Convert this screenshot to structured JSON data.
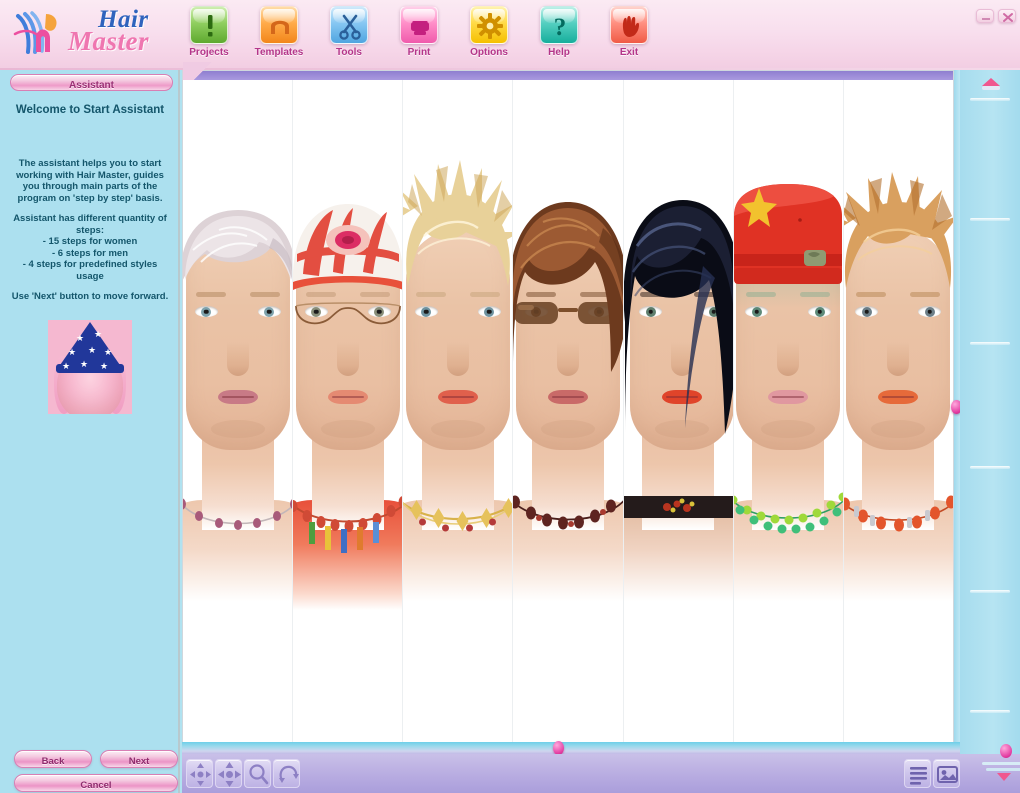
{
  "app": {
    "title_line1": "Hair",
    "title_line2": "Master",
    "logo_icon": "hm-monogram-icon"
  },
  "window_controls": [
    {
      "name": "minimize-button",
      "icon": "minimize-icon"
    },
    {
      "name": "close-button",
      "icon": "close-icon"
    }
  ],
  "toolbar": {
    "items": [
      {
        "label": "Projects",
        "icon": "exclamation-icon",
        "color": "#5ea92f"
      },
      {
        "label": "Templates",
        "icon": "hair-template-icon",
        "color": "#f2861a"
      },
      {
        "label": "Tools",
        "icon": "scissors-icon",
        "color": "#4fa5e0"
      },
      {
        "label": "Print",
        "icon": "printer-icon",
        "color": "#f05bac"
      },
      {
        "label": "Options",
        "icon": "gear-icon",
        "color": "#f5c000"
      },
      {
        "label": "Help",
        "icon": "question-mark-icon",
        "color": "#16ae9c"
      },
      {
        "label": "Exit",
        "icon": "hand-wave-icon",
        "color": "#f05b46"
      }
    ]
  },
  "sidebar": {
    "tab_label": "Assistant",
    "title": "Welcome to Start Assistant",
    "paragraph1": "The assistant helps you to start working with Hair Master, guides you through main parts of the program on 'step by step' basis.",
    "paragraph2_intro": "Assistant has different quantity of steps:",
    "steps": [
      "- 15 steps for women",
      "- 6 steps for men",
      "- 4 steps for predefined styles usage"
    ],
    "paragraph3": "Use 'Next' button to move forward.",
    "wizard_image_name": "assistant-wizard-portrait",
    "buttons": {
      "back": "Back",
      "next": "Next",
      "cancel": "Cancel"
    }
  },
  "canvas": {
    "name": "hairstyle-preview-canvas",
    "strips": [
      {
        "name": "portrait-strip-1",
        "hair_style": "short-platinum-pixie",
        "hair_color": "#e8dfe2",
        "hair_color_dark": "#c9bcc3",
        "skin": "#eac3a6",
        "eye_color": "#7fa3ad",
        "lip_color": "#c87a86",
        "accessory": "beaded-choker",
        "accessory_color": "#a85a7a"
      },
      {
        "name": "portrait-strip-2",
        "hair_style": "red-floral-headscarf",
        "hair_color": "#f2f0ee",
        "hair_color_dark": "#e03224",
        "skin": "#e9c0a2",
        "eye_color": "#8a8f7a",
        "lip_color": "#e58a72",
        "accessory": "coral-bead-necklace",
        "accessory_color": "#d04a36",
        "glasses": "rimless-oval-glasses"
      },
      {
        "name": "portrait-strip-3",
        "hair_style": "spiky-blonde",
        "hair_color": "#f0dda8",
        "hair_color_dark": "#cfa95e",
        "skin": "#ecc6a8",
        "eye_color": "#6f93a0",
        "lip_color": "#e0604c",
        "accessory": "gold-statement-necklace",
        "accessory_color": "#d8b24a"
      },
      {
        "name": "portrait-strip-4",
        "hair_style": "auburn-layered-bob",
        "hair_color": "#9c5a33",
        "hair_color_dark": "#6d3a1e",
        "skin": "#e9c1a3",
        "eye_color": "#6b4a33",
        "lip_color": "#c96a68",
        "accessory": "dark-bead-necklace",
        "accessory_color": "#5e2420",
        "glasses": "brown-sunglasses"
      },
      {
        "name": "portrait-strip-5",
        "hair_style": "black-asymmetric-sweep",
        "hair_color": "#1b1f33",
        "hair_color_dark": "#0a0c16",
        "skin": "#e3bb9e",
        "eye_color": "#5f7f6e",
        "lip_color": "#e0442a",
        "accessory": "black-leather-choker",
        "accessory_color": "#241b1b"
      },
      {
        "name": "portrait-strip-6",
        "hair_style": "red-military-cap",
        "hair_color": "#e03224",
        "hair_color_dark": "#b2221a",
        "skin": "#e8c2a6",
        "eye_color": "#5e8a79",
        "lip_color": "#e098a0",
        "accessory": "green-bead-necklace",
        "accessory_color": "#3fbf7a",
        "cap_star": "yellow-star"
      },
      {
        "name": "portrait-strip-7",
        "hair_style": "copper-spiky-short",
        "hair_color": "#d9a05f",
        "hair_color_dark": "#b4712f",
        "skin": "#edc8ab",
        "eye_color": "#6d7f88",
        "lip_color": "#e66a3a",
        "accessory": "orange-coral-necklace",
        "accessory_color": "#e3552c"
      }
    ]
  },
  "bottom_toolbar": {
    "left_tools": [
      {
        "name": "move-tool",
        "icon": "move-arrows-icon"
      },
      {
        "name": "pan-tool",
        "icon": "pan-arrows-icon"
      },
      {
        "name": "zoom-tool",
        "icon": "magnifier-icon"
      },
      {
        "name": "rotate-tool",
        "icon": "rotate-icon"
      }
    ],
    "right_tools": [
      {
        "name": "list-view-button",
        "icon": "list-lines-icon"
      },
      {
        "name": "image-view-button",
        "icon": "image-icon"
      }
    ]
  },
  "right_sidebar": {
    "name": "right-panel",
    "collapse_icon": "collapse-arrow-icon",
    "expand_icon": "expand-arrow-icon"
  },
  "colors": {
    "header_pink": "#f6d6e8",
    "sidebar_blue": "#ace0ef",
    "accent_magenta": "#e2399f",
    "bottom_purple": "#b8ace1",
    "canvas_white": "#ffffff"
  }
}
